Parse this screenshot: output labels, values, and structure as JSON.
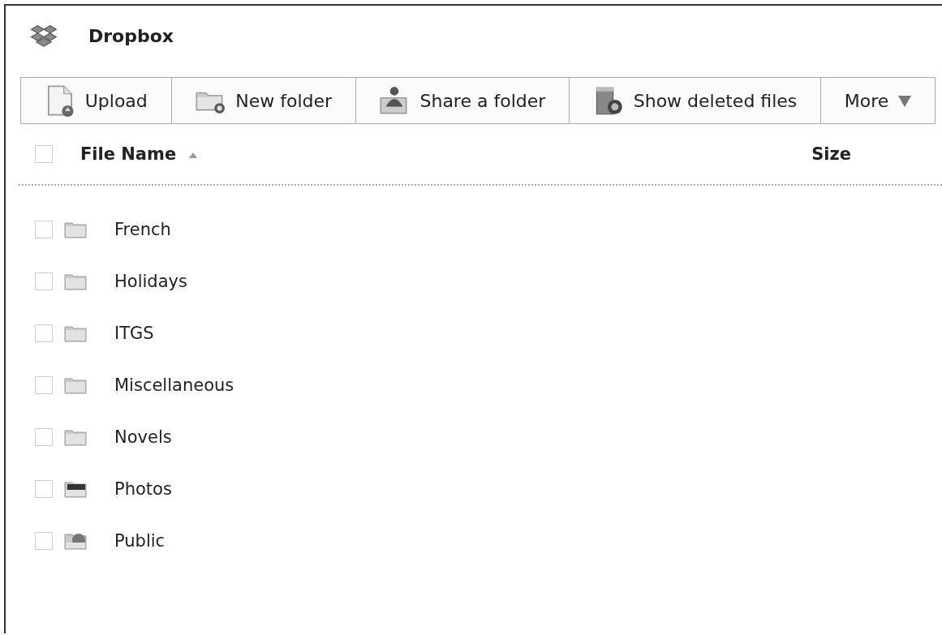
{
  "title": "Dropbox",
  "toolbar": [
    {
      "label": "Upload",
      "kind": "upload"
    },
    {
      "label": "New folder",
      "kind": "new-folder"
    },
    {
      "label": "Share a folder",
      "kind": "share"
    },
    {
      "label": "Show deleted files",
      "kind": "deleted"
    },
    {
      "label": "More",
      "kind": "more"
    }
  ],
  "table": {
    "select_all": {
      "checked": false
    },
    "columns": [
      {
        "label": "File Name",
        "sorted": true
      },
      {
        "label": "Size"
      }
    ],
    "rows": [
      {
        "name": "French",
        "kind": "folder",
        "checked": false
      },
      {
        "name": "Holidays",
        "kind": "folder",
        "checked": false
      },
      {
        "name": "ITGS",
        "kind": "folder",
        "checked": false
      },
      {
        "name": "Miscellaneous",
        "kind": "folder",
        "checked": false
      },
      {
        "name": "Novels",
        "kind": "folder",
        "checked": false
      },
      {
        "name": "Photos",
        "kind": "photos",
        "checked": false
      },
      {
        "name": "Public",
        "kind": "public",
        "checked": false
      }
    ]
  }
}
